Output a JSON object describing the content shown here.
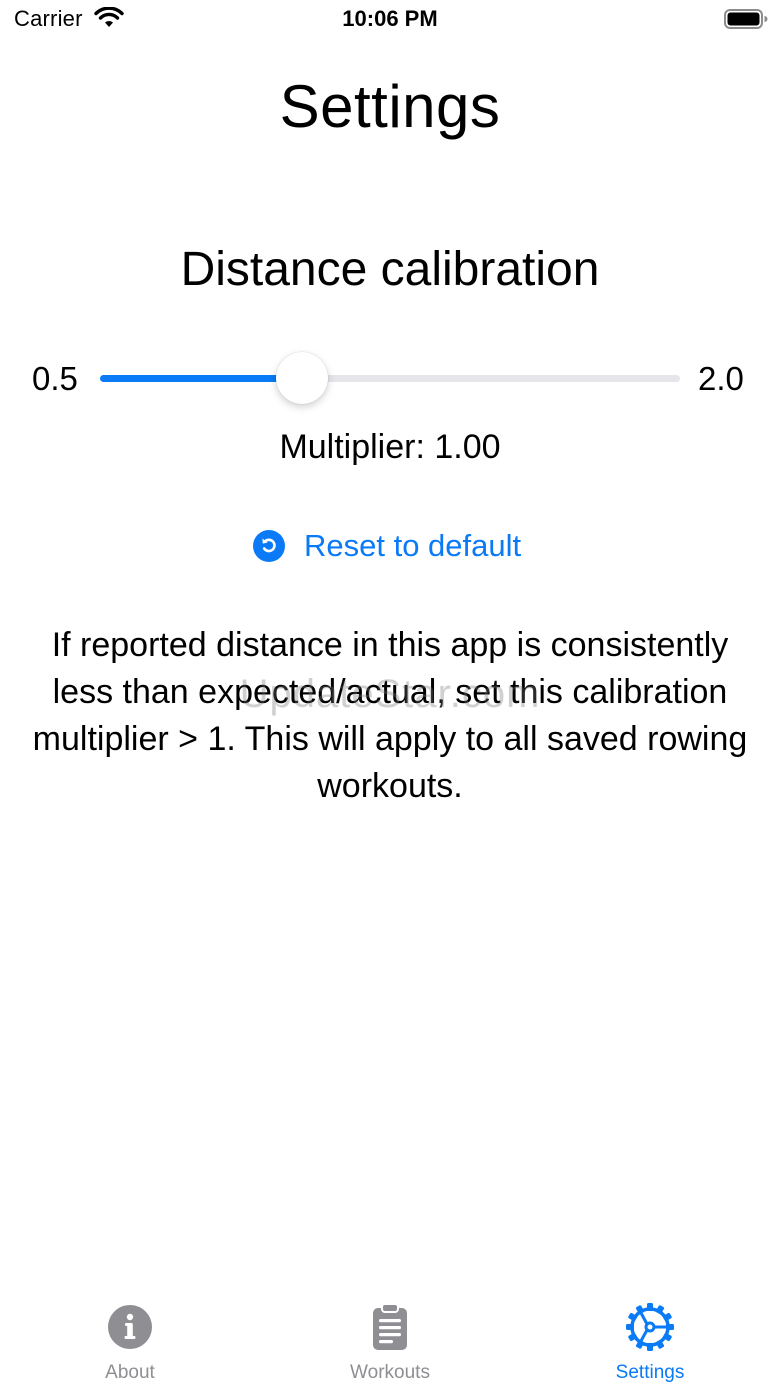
{
  "status_bar": {
    "carrier": "Carrier",
    "time": "10:06 PM",
    "icons": [
      "wifi-icon",
      "battery-icon"
    ]
  },
  "page": {
    "title": "Settings"
  },
  "calibration": {
    "title": "Distance calibration",
    "slider_min_label": "0.5",
    "slider_max_label": "2.0",
    "slider_min": 0.5,
    "slider_max": 2.0,
    "slider_value": 1.0,
    "multiplier_text": "Multiplier: 1.00",
    "reset_label": "Reset to default",
    "reset_icon": "reset-icon",
    "description": "If reported distance in this app is consistently less than expected/actual, set this calibration multiplier > 1.  This will apply to all saved rowing workouts."
  },
  "watermark": "UpdateStar.com",
  "tabs": [
    {
      "label": "About",
      "icon": "info-icon",
      "active": false
    },
    {
      "label": "Workouts",
      "icon": "clipboard-icon",
      "active": false
    },
    {
      "label": "Settings",
      "icon": "gear-icon",
      "active": true
    }
  ],
  "colors": {
    "accent": "#0a7af6",
    "inactive_tab": "#8e8e93",
    "track": "#e5e5ea"
  }
}
